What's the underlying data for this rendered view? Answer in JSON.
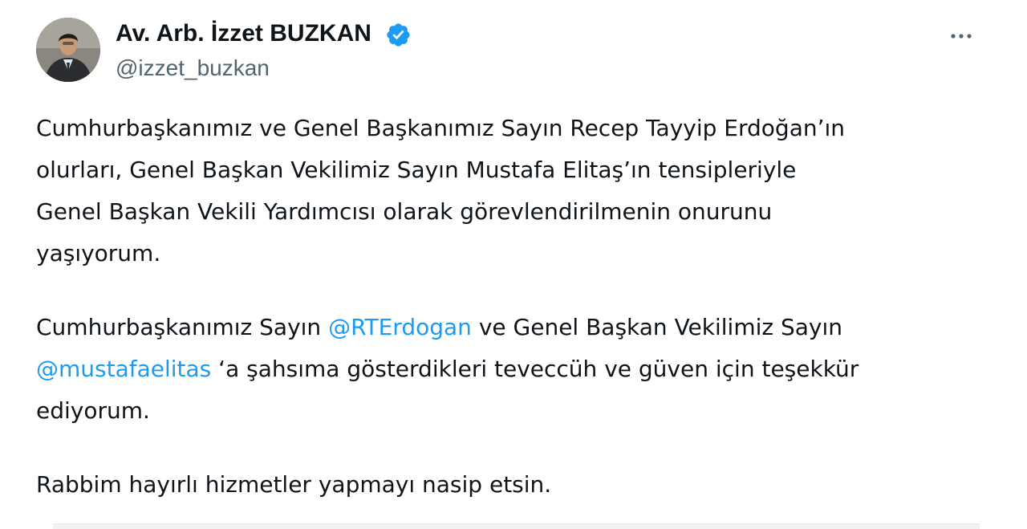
{
  "author": {
    "name": "Av. Arb. İzzet BUZKAN",
    "handle": "@izzet_buzkan",
    "verified_icon": "verified-badge-icon",
    "avatar_icon": "profile-photo"
  },
  "menu": {
    "icon": "more-horizontal-icon"
  },
  "tweet": {
    "p1_l1": "Cumhurbaşkanımız ve Genel Başkanımız  Sayın Recep Tayyip Erdoğan’ın",
    "p1_l2": "olurları, Genel Başkan Vekilimiz Sayın Mustafa Elitaş’ın tensipleriyle",
    "p1_l3": "Genel Başkan Vekili Yardımcısı olarak görevlendirilmenin onurunu",
    "p1_l4": "yaşıyorum.",
    "p2_l1_a": "Cumhurbaşkanımız Sayın ",
    "p2_l1_mention": "@RTErdogan",
    "p2_l1_b": " ve Genel Başkan Vekilimiz Sayın",
    "p2_l2_mention": "@mustafaelitas",
    "p2_l2_b": " ‘a şahsıma gösterdikleri teveccüh ve güven için teşekkür",
    "p2_l3": "ediyorum.",
    "p3_l1": "Rabbim hayırlı hizmetler yapmayı nasip etsin."
  },
  "colors": {
    "text": "#0f1419",
    "secondary": "#536471",
    "link": "#1d9bf0",
    "verified": "#1d9bf0"
  }
}
